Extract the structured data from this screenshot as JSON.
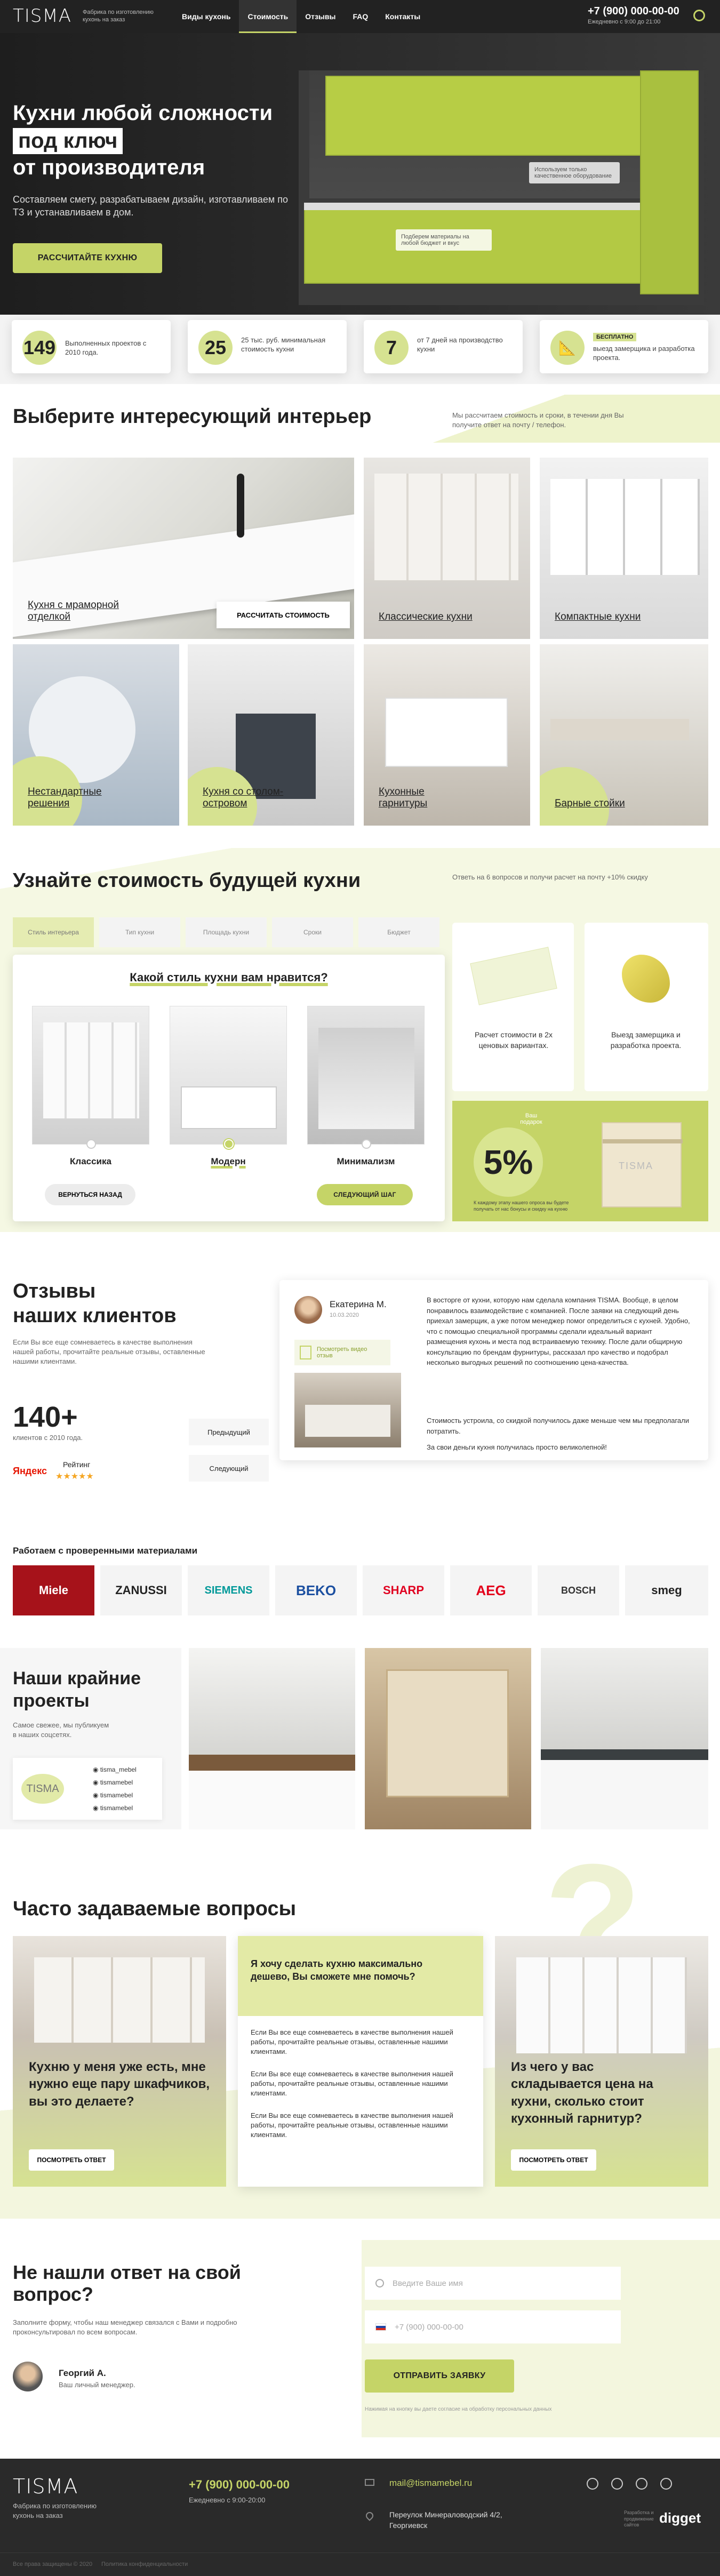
{
  "header": {
    "logo": "TISMA",
    "tagline": "Фабрика по изготовлению кухонь на заказ",
    "nav": [
      "Виды кухонь",
      "Стоимость",
      "Отзывы",
      "FAQ",
      "Контакты"
    ],
    "phone": "+7 (900) 000-00-00",
    "hours": "Ежедневно с 9:00 до 21:00"
  },
  "hero": {
    "title1": "Кухни любой сложности",
    "title2": "под ключ",
    "title3": "от производителя",
    "subtitle": "Составляем смету, разрабатываем дизайн, изготавливаем по ТЗ и устанавливаем в дом.",
    "cta": "Рассчитайте кухню",
    "tip1": "Используем только качественное оборудование",
    "tip2": "Подберем материалы на любой бюджет и вкус"
  },
  "stats": [
    {
      "num": "149",
      "text": "Выполненных проектов с 2010 года."
    },
    {
      "num": "25",
      "text": "25 тыс. руб. минимальная стоимость кухни"
    },
    {
      "num": "7",
      "text": "от 7 дней на производство кухни"
    },
    {
      "num": "",
      "badge": "БЕСПЛАТНО",
      "text": "выезд замерщика и разработка проекта."
    }
  ],
  "interior": {
    "title": "Выберите интересующий интерьер",
    "desc": "Мы рассчитаем стоимость и сроки, в течении дня Вы получите ответ на почту / телефон.",
    "calc_btn": "Рассчитать стоимость",
    "items": [
      "Кухня с мраморной отделкой",
      "Классические кухни",
      "Компактные кухни",
      "Нестандартные решения",
      "Кухня со столом-островом",
      "Кухонные гарнитуры",
      "Барные стойки"
    ]
  },
  "quiz": {
    "title": "Узнайте стоимость будущей кухни",
    "desc": "Ответь на 6 вопросов и получи расчет на почту +10% скидку",
    "tabs": [
      "Стиль интерьера",
      "Тип кухни",
      "Площадь кухни",
      "Сроки",
      "Бюджет"
    ],
    "question": "Какой стиль кухни вам нравится?",
    "options": [
      "Классика",
      "Модерн",
      "Минимализм"
    ],
    "back": "Вернуться назад",
    "next": "Следующий шаг",
    "benefit1": "Расчет стоимости в 2х ценовых вариантах.",
    "benefit2": "Выезд замерщика и разработка проекта.",
    "gift_label": "Ваш подарок",
    "discount": "5%",
    "gift_text": "К каждому этапу нашего опроса вы будете получать от нас бонусы и скидку на кухню"
  },
  "reviews": {
    "title1": "Отзывы",
    "title2": "наших клиентов",
    "desc": "Если Вы все еще сомневаетесь в качестве выполнения нашей работы, прочитайте реальные отзывы, оставленные нашими клиентами.",
    "count": "140+",
    "count_text": "клиентов с 2010 года.",
    "yandex": "Яндекс",
    "rating": "Рейтинг",
    "stars": "★★★★★",
    "prev": "Предыдущий",
    "next": "Следующий",
    "name": "Екатерина М.",
    "date": "10.03.2020",
    "video": "Посмотреть видео отзыв",
    "p1": "В восторге от кухни, которую нам сделала компания TISMA. Вообще, в целом понравилось взаимодействие с компанией. После заявки на следующий день приехал замерщик, а уже потом менеджер помог определиться с кухней. Удобно, что с помощью специальной программы сделали идеальный вариант размещения кухонь и места под встраиваемую технику. После дали общирную консультацию по брендам фурнитуры, рассказал про качество и подобрал несколько выгодных решений по соотношению цена-качества.",
    "p2": "Стоимость устроила, со скидкой получилось даже меньше чем мы предполагали потратить.",
    "p3": "За свои деньги кухня получилась просто великолепной!"
  },
  "partners": {
    "title": "Работаем с проверенными материалами",
    "brands": [
      "Miele",
      "ZANUSSI",
      "SIEMENS",
      "BEKO",
      "SHARP",
      "AEG",
      "BOSCH",
      "smeg"
    ]
  },
  "projects": {
    "title1": "Наши крайние",
    "title2": "проекты",
    "desc": "Самое свежее, мы публикуем в наших соцсетях.",
    "handles": [
      "tisma_mebel",
      "tismamebel",
      "tismamebel",
      "tismamebel"
    ]
  },
  "faq": {
    "title": "Часто задаваемые вопросы",
    "q1": "Кухню у меня уже есть, мне нужно еще пару шкафчиков, вы это делаете?",
    "q2": "Я хочу сделать кухню максимально дешево, Вы сможете мне помочь?",
    "q3": "Из чего у вас складывается цена на кухни, сколько стоит кухонный гарнитур?",
    "answer": "Если Вы все еще сомневаетесь в качестве выполнения нашей работы, прочитайте реальные отзывы, оставленные нашими клиентами.",
    "see": "Посмотреть ответ"
  },
  "contact": {
    "title": "Не нашли ответ на свой вопрос?",
    "desc": "Заполните форму, чтобы наш менеджер связался с Вами и подробно проконсультировал по всем вопросам.",
    "manager": "Георгий А.",
    "role": "Ваш личный менеджер.",
    "name_ph": "Введите Ваше имя",
    "phone_ph": "+7 (900) 000-00-00",
    "submit": "Отправить заявку",
    "agree": "Нажимая на кнопку вы даете согласие на обработку персональных данных"
  },
  "footer": {
    "logo": "TISMA",
    "tagline": "Фабрика по изготовлению кухонь на заказ",
    "phone": "+7 (900) 000-00-00",
    "hours": "Ежедневно с 9:00-20:00",
    "email": "mail@tismamebel.ru",
    "address": "Переулок Минераловодский 4/2, Георгиевск",
    "dev_note": "Разработка и продвижение сайтов",
    "dev": "digget",
    "copy": "Все права защищены © 2020",
    "policy": "Политика конфиденциальности"
  }
}
